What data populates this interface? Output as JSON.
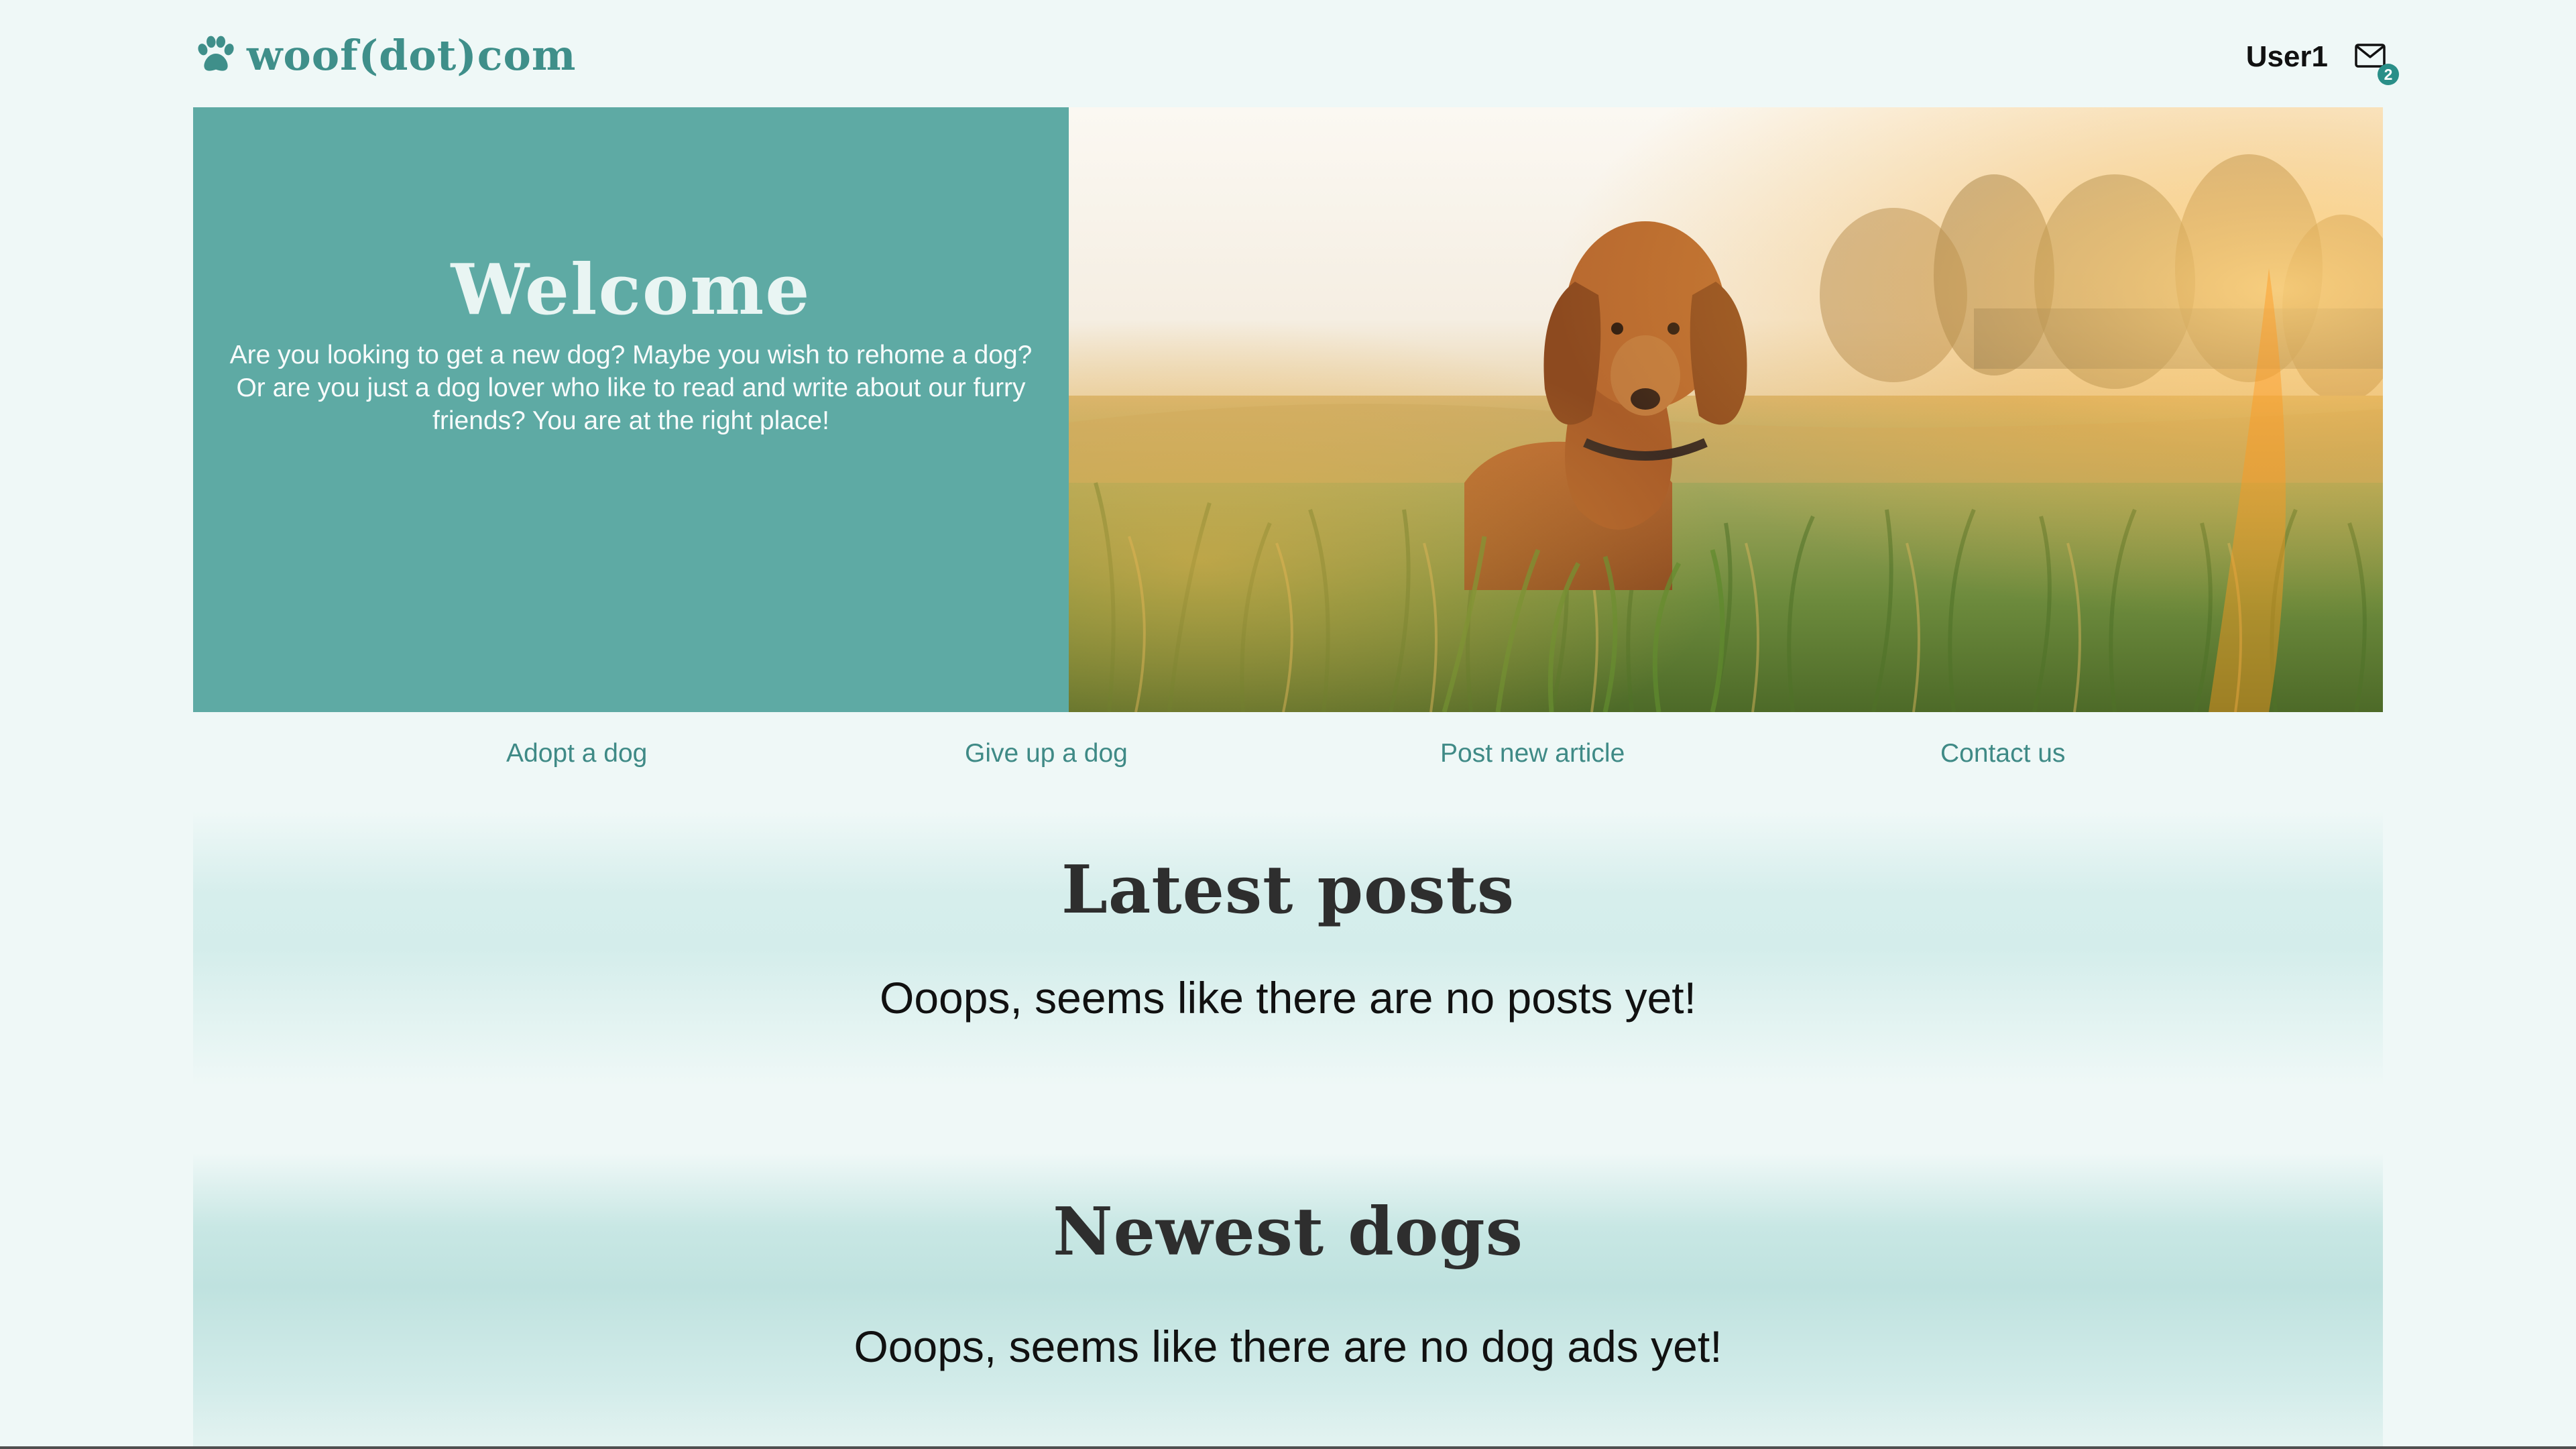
{
  "header": {
    "logo_text": "woof(dot)com",
    "logo_icon": "paw-icon",
    "username": "User1",
    "mail_icon": "envelope-icon",
    "mail_badge": "2"
  },
  "hero": {
    "title": "Welcome",
    "text": "Are you looking to get a new dog? Maybe you wish to rehome a dog? Or are you just a dog lover who like to read and write about our furry friends? You are at the right place!",
    "image": "dachshund-in-grass-photo"
  },
  "nav": {
    "links": [
      {
        "label": "Adopt a dog"
      },
      {
        "label": "Give up a dog"
      },
      {
        "label": "Post new article"
      },
      {
        "label": "Contact us"
      }
    ]
  },
  "latest_posts": {
    "title": "Latest posts",
    "empty_message": "Ooops, seems like there are no posts yet!"
  },
  "newest_dogs": {
    "title": "Newest dogs",
    "empty_message": "Ooops, seems like there are no dog ads yet!"
  },
  "colors": {
    "accent": "#5eaaa4",
    "link": "#3f8a86",
    "background": "#eff8f7",
    "badge": "#2a8f88"
  }
}
